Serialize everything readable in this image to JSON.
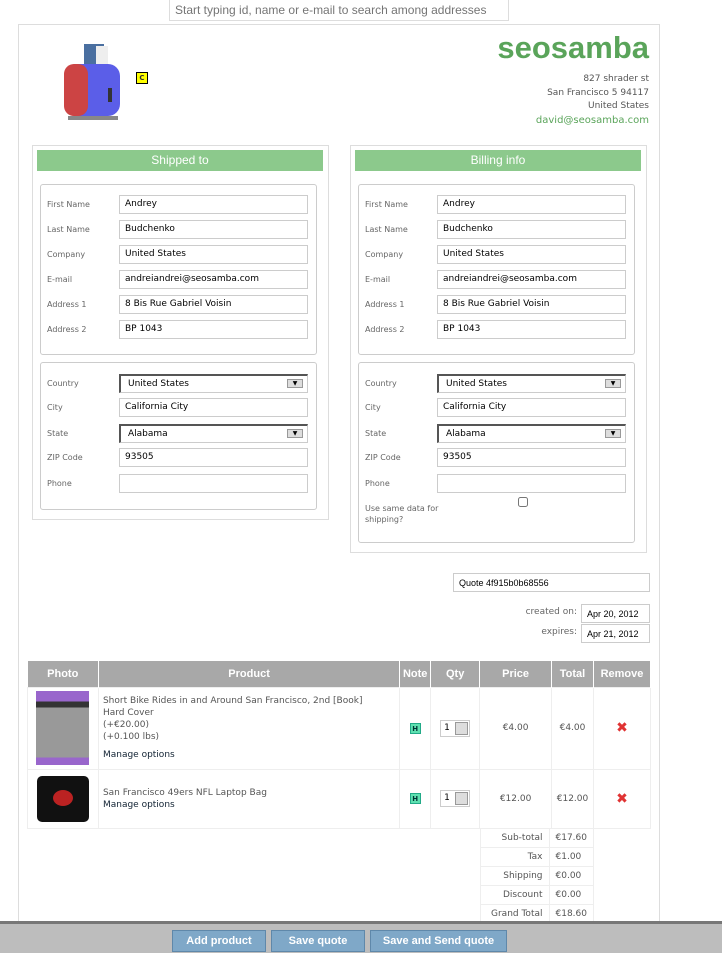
{
  "search": {
    "placeholder": "Start typing id, name or e-mail to search among addresses"
  },
  "company": {
    "name": "seosamba",
    "street": "827 shrader st",
    "city": "San Francisco 5 94117",
    "country": "United States",
    "email": "david@seosamba.com",
    "badge": "C"
  },
  "shipping": {
    "title": "Shipped to",
    "first_name": "Andrey",
    "last_name": "Budchenko",
    "company": "United States",
    "email": "andreiandrei@seosamba.com",
    "address1": "8 Bis Rue Gabriel Voisin",
    "address2": "BP 1043",
    "country": "United States",
    "city": "California City",
    "state": "Alabama",
    "zip": "93505",
    "phone": ""
  },
  "billing": {
    "title": "Billing info",
    "first_name": "Andrey",
    "last_name": "Budchenko",
    "company": "United States",
    "email": "andreiandrei@seosamba.com",
    "address1": "8 Bis Rue Gabriel Voisin",
    "address2": "BP 1043",
    "country": "United States",
    "city": "California City",
    "state": "Alabama",
    "zip": "93505",
    "phone": "",
    "same_label": "Use same data for shipping?",
    "same_checked": false
  },
  "labels": {
    "first_name": "First Name",
    "last_name": "Last Name",
    "company": "Company",
    "email": "E-mail",
    "address1": "Address 1",
    "address2": "Address 2",
    "country": "Country",
    "city": "City",
    "state": "State",
    "zip": "ZIP Code",
    "phone": "Phone"
  },
  "quote": {
    "title": "Quote 4f915b0b68556",
    "created_label": "created on:",
    "created": "Apr 20, 2012",
    "expires_label": "expires:",
    "expires": "Apr 21, 2012"
  },
  "table": {
    "headers": [
      "Photo",
      "Product",
      "Note",
      "Qty",
      "Price",
      "Total",
      "Remove"
    ],
    "rows": [
      {
        "lines": [
          "Short Bike Rides in and Around San Francisco, 2nd [Book]",
          "Hard Cover",
          "(+€20.00)",
          "(+0.100 lbs)"
        ],
        "manage": "Manage options",
        "note": "H",
        "qty": "1",
        "price": "€4.00",
        "total": "€4.00"
      },
      {
        "lines": [
          "San Francisco 49ers NFL Laptop Bag"
        ],
        "manage": "Manage options",
        "note": "H",
        "qty": "1",
        "price": "€12.00",
        "total": "€12.00"
      }
    ]
  },
  "totals": [
    {
      "label": "Sub-total",
      "value": "€17.60"
    },
    {
      "label": "Tax",
      "value": "€1.00"
    },
    {
      "label": "Shipping",
      "value": "€0.00"
    },
    {
      "label": "Discount",
      "value": "€0.00"
    },
    {
      "label": "Grand Total",
      "value": "€18.60"
    }
  ],
  "buttons": {
    "add": "Add product",
    "save": "Save quote",
    "send": "Save and Send quote"
  },
  "colors": {
    "accent": "#5aa45a",
    "panel_header": "#8cc98c",
    "button": "#7fa8c8",
    "remove": "#e03333"
  }
}
